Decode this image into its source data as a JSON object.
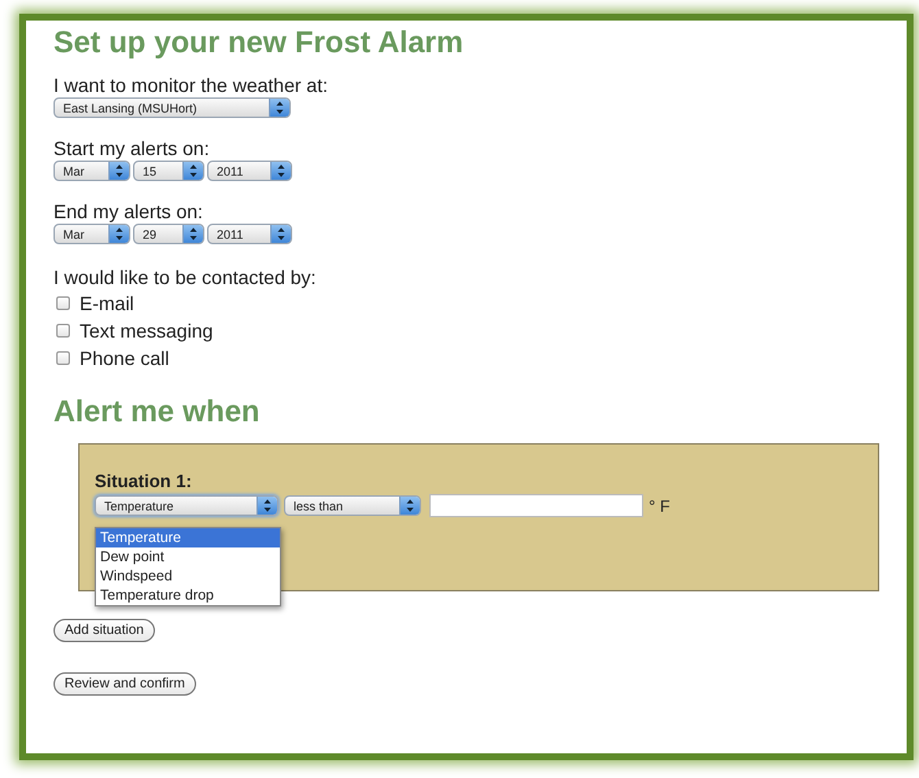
{
  "title": "Set up your new Frost Alarm",
  "location": {
    "label": "I want to monitor the weather at:",
    "value": "East Lansing (MSUHort)"
  },
  "start": {
    "label": "Start my alerts on:",
    "month": "Mar",
    "day": "15",
    "year": "2011"
  },
  "end": {
    "label": "End my alerts on:",
    "month": "Mar",
    "day": "29",
    "year": "2011"
  },
  "contact": {
    "label": "I would like to be contacted by:",
    "options": [
      {
        "label": "E-mail",
        "checked": false
      },
      {
        "label": "Text messaging",
        "checked": false
      },
      {
        "label": "Phone call",
        "checked": false
      }
    ]
  },
  "alerts_heading": "Alert me when",
  "situations": [
    {
      "label": "Situation 1:",
      "variable": "Temperature",
      "comparison": "less than",
      "unit": "° F",
      "open_list": [
        {
          "label": "Temperature",
          "selected": true
        },
        {
          "label": "Dew point",
          "selected": false
        },
        {
          "label": "Windspeed",
          "selected": false
        },
        {
          "label": "Temperature drop",
          "selected": false
        }
      ]
    }
  ],
  "buttons": [
    "Add situation",
    "Review and confirm"
  ]
}
